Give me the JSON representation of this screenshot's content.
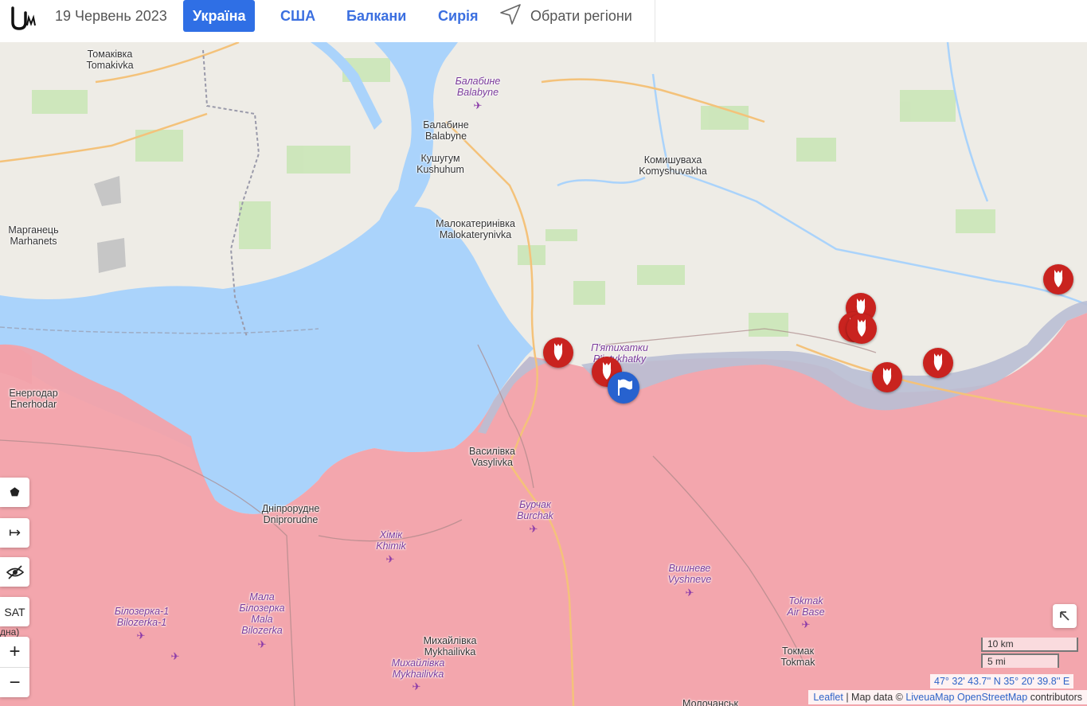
{
  "header": {
    "date": "19 Червень 2023",
    "tabs": [
      {
        "label": "Україна",
        "active": true
      },
      {
        "label": "США",
        "active": false
      },
      {
        "label": "Балкани",
        "active": false
      },
      {
        "label": "Сирія",
        "active": false
      }
    ],
    "region_button": "Обрати регіони"
  },
  "colors": {
    "occupied": "#f0a0a8",
    "water": "#aad3fb",
    "contested": "#b9bfd4",
    "marker": "#c9231f",
    "flag": "#2762cf",
    "accent": "#2f6fe5"
  },
  "map": {
    "places": [
      {
        "ua": "Томаківка",
        "en": "Tomakivka"
      },
      {
        "ua": "Балабине",
        "en": "Balabyne",
        "airfield": true
      },
      {
        "ua": "Балабине",
        "en": "Balabyne"
      },
      {
        "ua": "Кушугум",
        "en": "Kushuhum"
      },
      {
        "ua": "Комишуваха",
        "en": "Komyshuvakha"
      },
      {
        "ua": "Марганець",
        "en": "Marhanets"
      },
      {
        "ua": "Малокатеринівка",
        "en": "Malokaterynivka"
      },
      {
        "ua": "П'ятихатки",
        "en": "P'iatykhatky"
      },
      {
        "ua": "Енергодар",
        "en": "Enerhodar"
      },
      {
        "ua": "Василівка",
        "en": "Vasylivka"
      },
      {
        "ua": "Бурчак",
        "en": "Burchak",
        "airfield": true
      },
      {
        "ua": "Дніпрорудне",
        "en": "Dniprorudne"
      },
      {
        "ua": "Хімік",
        "en": "Khimik",
        "airfield": true
      },
      {
        "ua": "Мала Білозерка",
        "en": "Mala Bilozerka",
        "airfield": true
      },
      {
        "ua": "Білозерка-1",
        "en": "Bilozerka-1",
        "airfield": true
      },
      {
        "ua": "Вишневе",
        "en": "Vyshneve",
        "airfield": true
      },
      {
        "ua": "Tokmak",
        "en": "Air Base",
        "airfield": true
      },
      {
        "ua": "Михайлівка",
        "en": "Mykhailivka"
      },
      {
        "ua": "Михайлівка",
        "en": "Mykhailivka",
        "airfield": true
      },
      {
        "ua": "Токмак",
        "en": "Tokmak"
      },
      {
        "ua": "Молочанськ",
        "en": ""
      }
    ],
    "partial_label": "дна)",
    "events": [
      {
        "icon": "bomb-icon"
      },
      {
        "icon": "bomb-icon"
      },
      {
        "icon": "bomb-icon"
      },
      {
        "icon": "bomb-icon"
      },
      {
        "icon": "bomb-icon"
      },
      {
        "icon": "bomb-icon"
      },
      {
        "icon": "bomb-icon"
      },
      {
        "icon": "flag-icon"
      }
    ],
    "controls": {
      "polygon": "⬟",
      "measure": "↦",
      "hide": "hide",
      "sat": "SAT",
      "zoom_in": "+",
      "zoom_out": "−"
    },
    "scale": {
      "km": "10 km",
      "mi": "5 mi"
    },
    "coordinates": "47° 32' 43.7'' N 35° 20' 39.8'' E",
    "attribution": {
      "leaflet": "Leaflet",
      "separator": " | Map data © ",
      "liveuamap": "LiveuaMap",
      "osm": "OpenStreetMap",
      "contributors": " contributors"
    }
  }
}
